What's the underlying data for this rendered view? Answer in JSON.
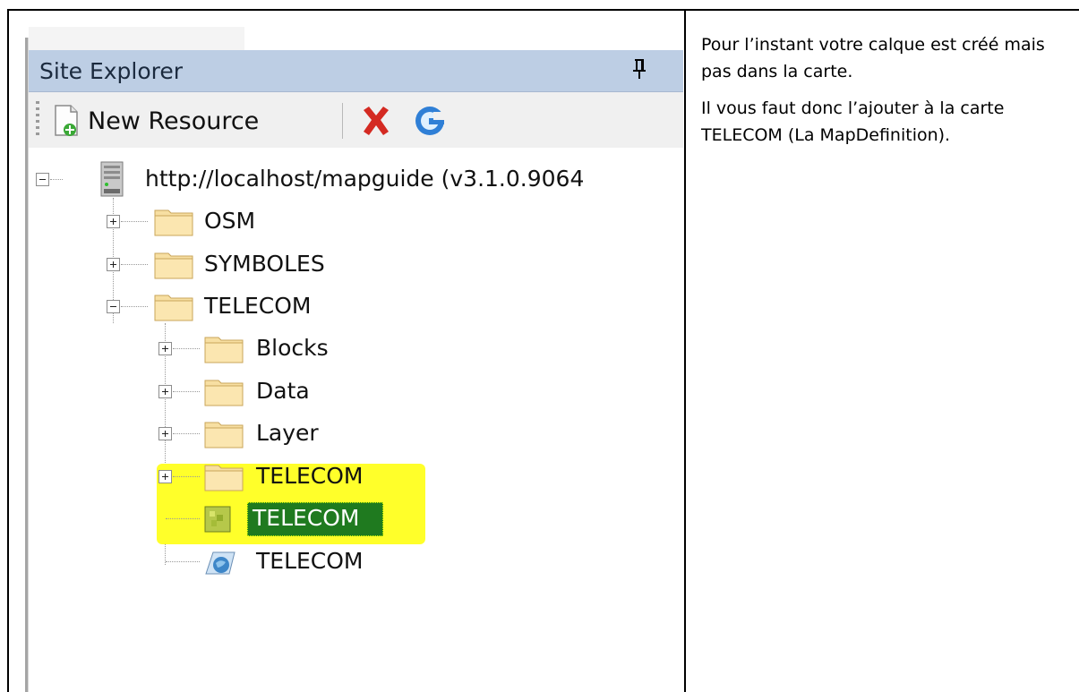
{
  "panel": {
    "title": "Site Explorer",
    "pin_icon": "pin-icon"
  },
  "toolbar": {
    "new_resource_label": "New Resource",
    "delete_icon": "delete-icon",
    "refresh_icon": "refresh-icon"
  },
  "tree": {
    "root": "http://localhost/mapguide (v3.1.0.9064",
    "osm": "OSM",
    "symboles": "SYMBOLES",
    "telecom": "TELECOM",
    "blocks": "Blocks",
    "data": "Data",
    "layer": "Layer",
    "telecom_folder": "TELECOM",
    "telecom_layer": "TELECOM",
    "telecom_map": "TELECOM"
  },
  "note": {
    "line1": "Pour l’instant votre calque est créé mais pas dans la carte.",
    "line2": "Il vous faut donc l’ajouter à la carte TELECOM (La MapDefinition)."
  },
  "colors": {
    "highlight": "#ffff2a",
    "selection": "#1f7a1f",
    "header": "#bdcee4"
  }
}
